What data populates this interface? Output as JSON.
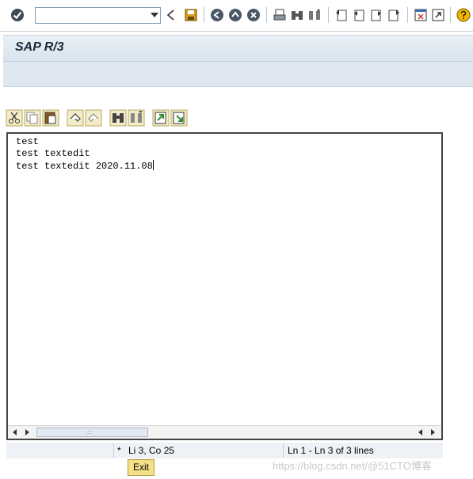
{
  "toolbar": {
    "command_field": {
      "value": "",
      "placeholder": ""
    },
    "icons": [
      "enter-icon",
      "back-icon",
      "save-icon",
      "exit-icon",
      "cancel-icon",
      "print-icon",
      "find-icon",
      "find-next-icon",
      "first-page-icon",
      "previous-page-icon",
      "next-page-icon",
      "last-page-icon",
      "create-session-icon",
      "create-shortcut-icon",
      "help-icon"
    ]
  },
  "title": {
    "text": "SAP R/3"
  },
  "editor": {
    "toolbar_icons": [
      "cut-icon",
      "copy-icon",
      "paste-icon",
      "undo-icon",
      "redo-icon",
      "find-icon",
      "find-next-icon",
      "load-local-file-icon",
      "save-local-file-icon"
    ],
    "lines": [
      "test",
      "test textedit",
      "test textedit 2020.11.08"
    ],
    "scroll_grip": ":::"
  },
  "status": {
    "modified_marker": "*",
    "cursor_position": "Li 3, Co 25",
    "line_count": "Ln 1 - Ln 3 of 3 lines"
  },
  "exit_button": {
    "label": "Exit"
  },
  "watermark": "https://blog.csdn.net/@51CTO博客",
  "colors": {
    "accent_yellow": "#f5e08a",
    "titlebar": "#dce6f0",
    "icon_green": "#2e8b2e",
    "icon_blue": "#3a6fb0"
  }
}
